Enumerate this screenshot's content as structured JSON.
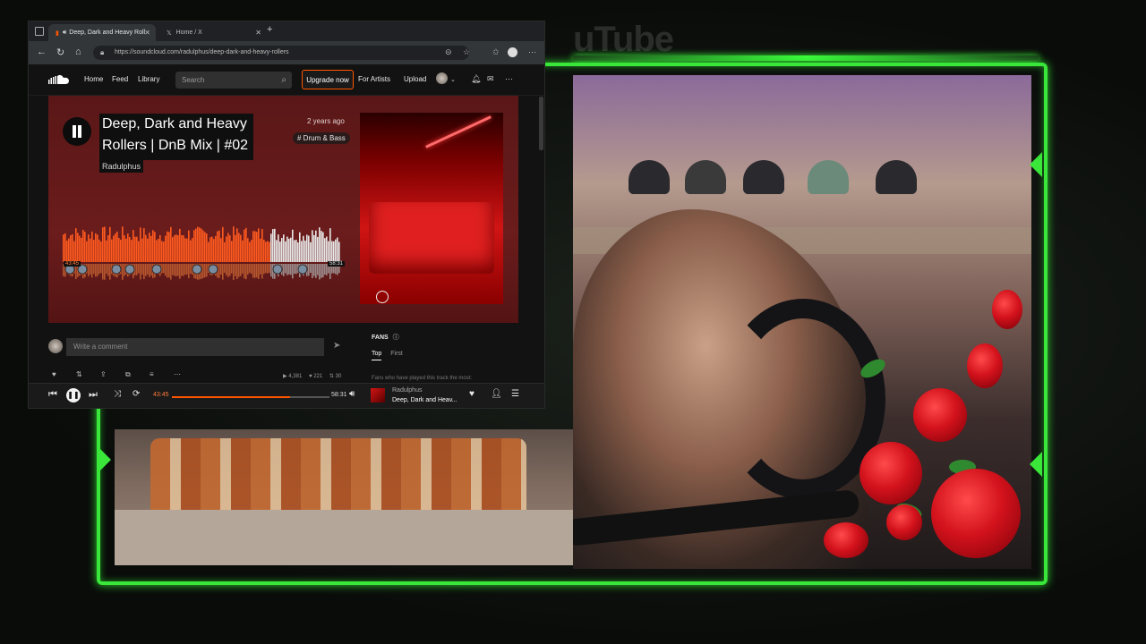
{
  "overlay": {
    "logo_text": "uTube",
    "accent": "#39e639"
  },
  "browser": {
    "tabs": [
      {
        "label": "Deep, Dark and Heavy Roll",
        "icon": "soundcloud-favicon"
      },
      {
        "label": "Home / X",
        "icon": "x-favicon"
      }
    ],
    "url": "https://soundcloud.com/radulphus/deep-dark-and-heavy-rollers"
  },
  "soundcloud": {
    "nav": {
      "home": "Home",
      "feed": "Feed",
      "library": "Library",
      "search_placeholder": "Search",
      "upgrade": "Upgrade now",
      "for_artists": "For Artists",
      "upload": "Upload"
    },
    "track": {
      "title_line1": "Deep, Dark and Heavy",
      "title_line2": "Rollers | DnB Mix | #02",
      "artist": "Radulphus",
      "posted": "2 years ago",
      "tag": "# Drum & Bass",
      "time_elapsed": "43:45",
      "time_total": "58:31",
      "progress": 0.748
    },
    "comments": {
      "placeholder": "Write a comment"
    },
    "fans": {
      "heading": "FANS",
      "tab_top": "Top",
      "tab_first": "First",
      "note": "Fans who have played this track the most:"
    },
    "stats": {
      "plays": "4,381",
      "likes": "221",
      "reposts": "30"
    },
    "player": {
      "elapsed": "43:45",
      "total": "58:31",
      "artist": "Radulphus",
      "title": "Deep, Dark and Heav..."
    },
    "colors": {
      "brand": "#ff5500",
      "hero_bg": "#6b1c1c"
    }
  }
}
